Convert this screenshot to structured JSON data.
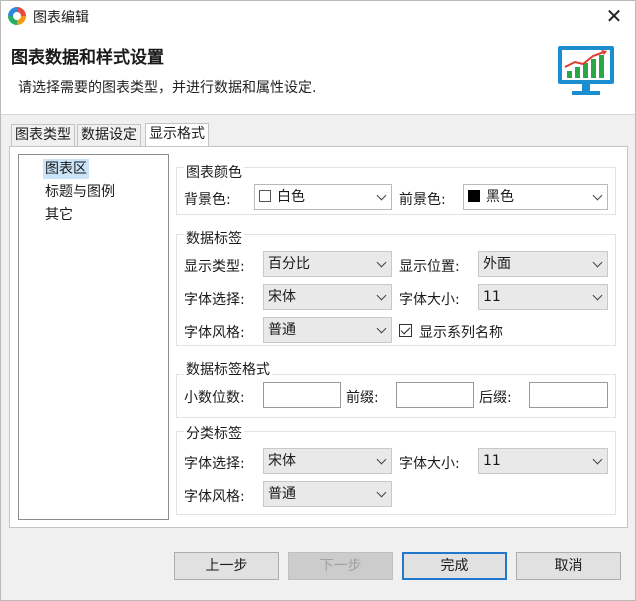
{
  "window": {
    "title": "图表编辑",
    "close_symbol": "✕"
  },
  "header": {
    "title": "图表数据和样式设置",
    "description": "请选择需要的图表类型，并进行数据和属性设定."
  },
  "tabs": [
    {
      "label": "图表类型",
      "active": false
    },
    {
      "label": "数据设定",
      "active": false
    },
    {
      "label": "显示格式",
      "active": true
    }
  ],
  "tree": {
    "items": [
      {
        "label": "图表区",
        "selected": true
      },
      {
        "label": "标题与图例",
        "selected": false
      },
      {
        "label": "其它",
        "selected": false
      }
    ]
  },
  "chart_color": {
    "title": "图表颜色",
    "bg_label": "背景色:",
    "bg_value": "白色",
    "bg_swatch": "#ffffff",
    "fg_label": "前景色:",
    "fg_value": "黑色",
    "fg_swatch": "#000000"
  },
  "data_labels": {
    "title": "数据标签",
    "type_label": "显示类型:",
    "type_value": "百分比",
    "position_label": "显示位置:",
    "position_value": "外面",
    "font_label": "字体选择:",
    "font_value": "宋体",
    "size_label": "字体大小:",
    "size_value": "11",
    "style_label": "字体风格:",
    "style_value": "普通",
    "show_series_label": "显示系列名称",
    "show_series_checked": true
  },
  "label_format": {
    "title": "数据标签格式",
    "decimals_label": "小数位数:",
    "decimals_value": "",
    "prefix_label": "前缀:",
    "prefix_value": "",
    "suffix_label": "后缀:",
    "suffix_value": ""
  },
  "category_labels": {
    "title": "分类标签",
    "font_label": "字体选择:",
    "font_value": "宋体",
    "size_label": "字体大小:",
    "size_value": "11",
    "style_label": "字体风格:",
    "style_value": "普通"
  },
  "buttons": {
    "prev": "上一步",
    "next": "下一步",
    "finish": "完成",
    "cancel": "取消"
  },
  "icons": {
    "app": "app-logo-icon",
    "header": "chart-monitor-icon",
    "close": "close-icon",
    "dropdown": "chevron-down-icon",
    "check": "checkbox-icon"
  },
  "colors": {
    "accent": "#2277cc",
    "selection": "#cce4f7",
    "chart_bars": "#2aa845",
    "chart_line": "#e03c31",
    "monitor": "#1a8ed0"
  }
}
